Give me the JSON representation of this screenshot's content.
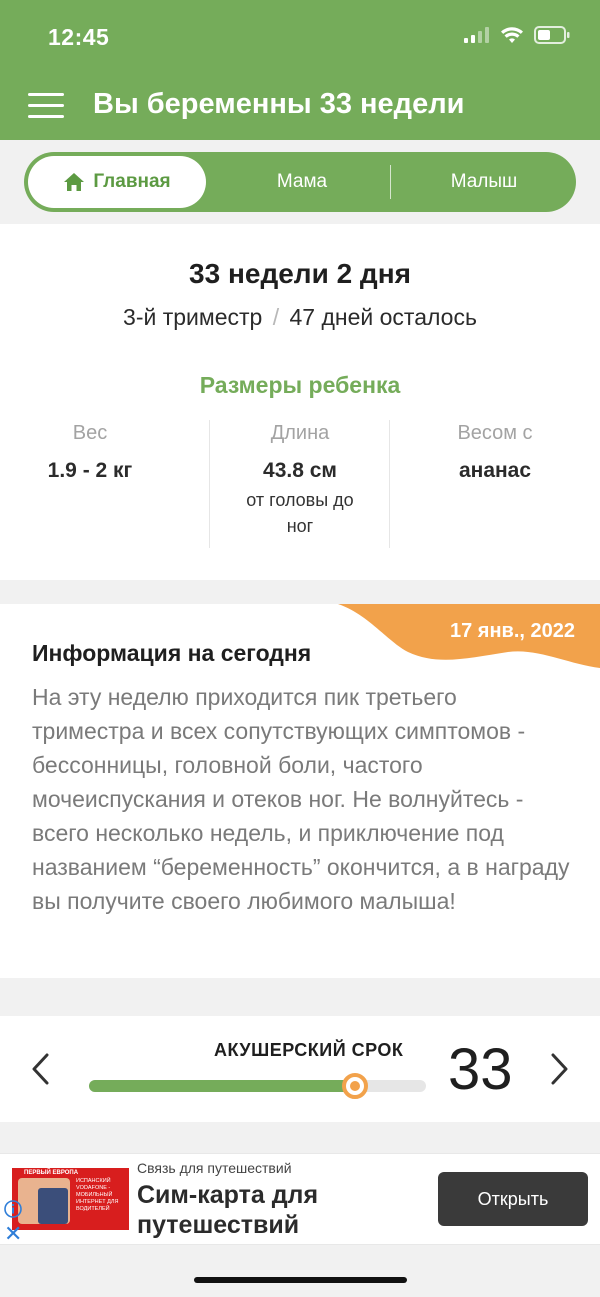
{
  "status_bar": {
    "time": "12:45"
  },
  "header": {
    "title": "Вы беременны 33 недели"
  },
  "tabs": [
    {
      "label": "Главная",
      "active": true
    },
    {
      "label": "Мама",
      "active": false
    },
    {
      "label": "Малыш",
      "active": false
    }
  ],
  "week_card": {
    "title": "33 недели 2 дня",
    "trimester": "3-й триместр",
    "separator": "/",
    "days_left": "47 дней осталось",
    "sizes_title": "Размеры ребенка",
    "metrics": [
      {
        "label": "Вес",
        "value": "1.9 - 2 кг",
        "note": ""
      },
      {
        "label": "Длина",
        "value": "43.8 см",
        "note": "от головы до ног"
      },
      {
        "label": "Весом с",
        "value": "ананас",
        "note": ""
      }
    ]
  },
  "info_card": {
    "date": "17 янв., 2022",
    "title": "Информация на сегодня",
    "body": "На эту неделю приходится пик третьего триместра и всех сопутствующих симптомов - бессонницы, головной боли, частого мочеиспускания и отеков ног. Не волнуйтесь - всего несколько недель, и приключение под названием “беременность” окончится, а в награду вы получите своего любимого малыша!"
  },
  "term": {
    "label": "АКУШЕРСКИЙ СРОК",
    "week": "33",
    "progress": 0.79
  },
  "ad": {
    "sponsor": "Связь для путешествий",
    "headline": "Сим-карта для путешествий",
    "button": "Открыть",
    "image_brand": "ПЕРВЫЙ ЕВРОПА",
    "image_text": "ИСПАНСКИЙ VODAFONE - МОБИЛЬНЫЙ ИНТЕРНЕТ ДЛЯ ВОДИТЕЛЕЙ"
  },
  "colors": {
    "brand_green": "#75ac5a",
    "accent_orange": "#f2a24b",
    "ad_button": "#3a3a3a"
  }
}
